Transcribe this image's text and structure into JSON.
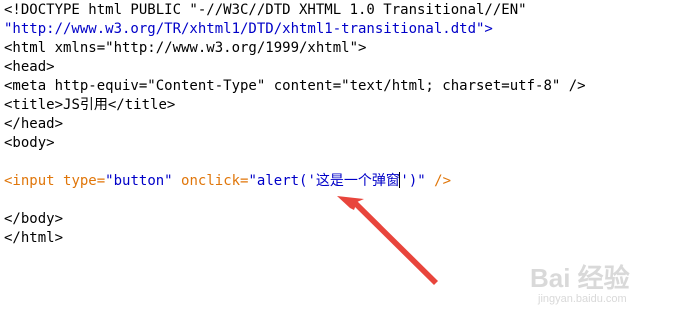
{
  "code_lines": {
    "l1": "<!DOCTYPE html PUBLIC \"-//W3C//DTD XHTML 1.0 Transitional//EN\"",
    "l2": "\"http://www.w3.org/TR/xhtml1/DTD/xhtml1-transitional.dtd\">",
    "l3": "<html xmlns=\"http://www.w3.org/1999/xhtml\">",
    "l4": "<head>",
    "l5": "<meta http-equiv=\"Content-Type\" content=\"text/html; charset=utf-8\" />",
    "l6_open": "<title>",
    "l6_text": "JS引用",
    "l6_close": "</title>",
    "l7": "</head>",
    "l8": "<body>",
    "l10_tag": "<input",
    "l10_attr1": "type=",
    "l10_val1": "\"button\"",
    "l10_attr2": "onclick=",
    "l10_val2a": "\"alert('这是一个弹窗",
    "l10_val2b": "')\"",
    "l10_end": "/>",
    "l12": "</body>",
    "l13": "</html>"
  },
  "colors": {
    "default": "#000000",
    "string": "#0000c8",
    "tag_highlight": "#e0760a",
    "arrow": "#e8453c"
  },
  "watermark": {
    "brand": "Bai 经验",
    "url": "jingyan.baidu.com"
  }
}
